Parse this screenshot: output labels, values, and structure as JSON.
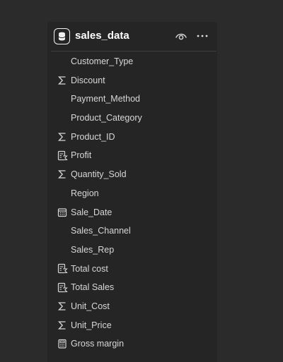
{
  "table": {
    "name": "sales_data",
    "icon": "database-icon"
  },
  "header_actions": [
    {
      "icon": "eye-icon"
    },
    {
      "icon": "more-options-icon"
    }
  ],
  "fields": [
    {
      "label": "Customer_Type",
      "icon": "none"
    },
    {
      "label": "Discount",
      "icon": "sigma-icon"
    },
    {
      "label": "Payment_Method",
      "icon": "none"
    },
    {
      "label": "Product_Category",
      "icon": "none"
    },
    {
      "label": "Product_ID",
      "icon": "sigma-icon"
    },
    {
      "label": "Profit",
      "icon": "measure-icon"
    },
    {
      "label": "Quantity_Sold",
      "icon": "sigma-icon"
    },
    {
      "label": "Region",
      "icon": "none"
    },
    {
      "label": "Sale_Date",
      "icon": "calendar-icon"
    },
    {
      "label": "Sales_Channel",
      "icon": "none"
    },
    {
      "label": "Sales_Rep",
      "icon": "none"
    },
    {
      "label": "Total cost",
      "icon": "measure-icon"
    },
    {
      "label": "Total Sales",
      "icon": "measure-icon"
    },
    {
      "label": "Unit_Cost",
      "icon": "sigma-icon"
    },
    {
      "label": "Unit_Price",
      "icon": "sigma-icon"
    },
    {
      "label": "Gross margin",
      "icon": "calculator-icon"
    }
  ],
  "colors": {
    "background": "#2b2b2b",
    "panel": "#252525",
    "text": "#d8d8d8",
    "title": "#ffffff"
  }
}
